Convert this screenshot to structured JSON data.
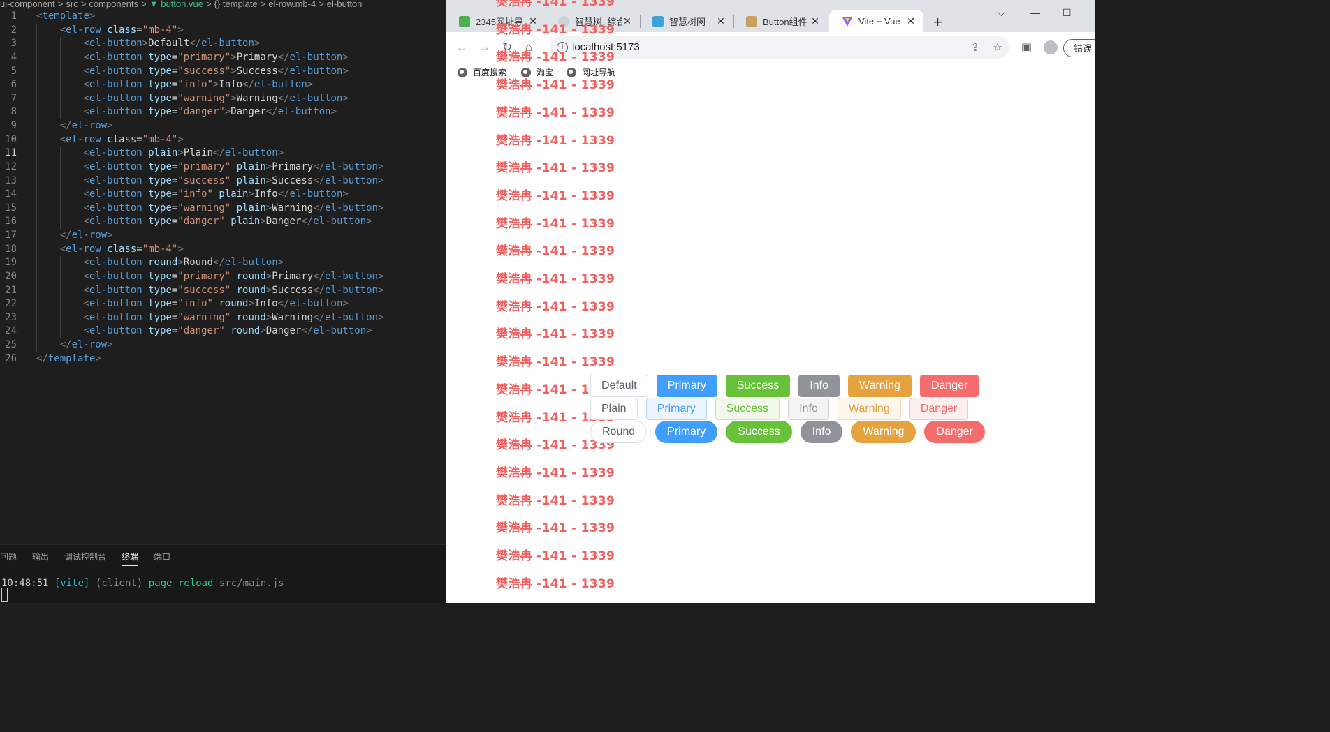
{
  "editor": {
    "breadcrumbs": [
      "ui-component",
      ">",
      "src",
      ">",
      "components",
      ">",
      "button.vue",
      ">",
      "{} template",
      ">",
      "el-row.mb-4",
      ">",
      "el-button"
    ],
    "lines": [
      {
        "n": "1",
        "indent": 1,
        "tokens": [
          [
            "g",
            "<"
          ],
          [
            "t",
            "template"
          ],
          [
            "g",
            ">"
          ]
        ]
      },
      {
        "n": "2",
        "indent": 2,
        "tokens": [
          [
            "g",
            "<"
          ],
          [
            "t",
            "el-row"
          ],
          [
            "txt",
            " "
          ],
          [
            "a",
            "class"
          ],
          [
            "txt",
            "="
          ],
          [
            "s",
            "\"mb-4\""
          ],
          [
            "g",
            ">"
          ]
        ]
      },
      {
        "n": "3",
        "indent": 3,
        "tokens": [
          [
            "g",
            "<"
          ],
          [
            "t",
            "el-button"
          ],
          [
            "g",
            ">"
          ],
          [
            "txt",
            "Default"
          ],
          [
            "g",
            "</"
          ],
          [
            "t",
            "el-button"
          ],
          [
            "g",
            ">"
          ]
        ]
      },
      {
        "n": "4",
        "indent": 3,
        "tokens": [
          [
            "g",
            "<"
          ],
          [
            "t",
            "el-button"
          ],
          [
            "txt",
            " "
          ],
          [
            "a",
            "type"
          ],
          [
            "txt",
            "="
          ],
          [
            "s",
            "\"primary\""
          ],
          [
            "g",
            ">"
          ],
          [
            "txt",
            "Primary"
          ],
          [
            "g",
            "</"
          ],
          [
            "t",
            "el-button"
          ],
          [
            "g",
            ">"
          ]
        ]
      },
      {
        "n": "5",
        "indent": 3,
        "tokens": [
          [
            "g",
            "<"
          ],
          [
            "t",
            "el-button"
          ],
          [
            "txt",
            " "
          ],
          [
            "a",
            "type"
          ],
          [
            "txt",
            "="
          ],
          [
            "s",
            "\"success\""
          ],
          [
            "g",
            ">"
          ],
          [
            "txt",
            "Success"
          ],
          [
            "g",
            "</"
          ],
          [
            "t",
            "el-button"
          ],
          [
            "g",
            ">"
          ]
        ]
      },
      {
        "n": "6",
        "indent": 3,
        "tokens": [
          [
            "g",
            "<"
          ],
          [
            "t",
            "el-button"
          ],
          [
            "txt",
            " "
          ],
          [
            "a",
            "type"
          ],
          [
            "txt",
            "="
          ],
          [
            "s",
            "\"info\""
          ],
          [
            "g",
            ">"
          ],
          [
            "txt",
            "Info"
          ],
          [
            "g",
            "</"
          ],
          [
            "t",
            "el-button"
          ],
          [
            "g",
            ">"
          ]
        ]
      },
      {
        "n": "7",
        "indent": 3,
        "tokens": [
          [
            "g",
            "<"
          ],
          [
            "t",
            "el-button"
          ],
          [
            "txt",
            " "
          ],
          [
            "a",
            "type"
          ],
          [
            "txt",
            "="
          ],
          [
            "s",
            "\"warning\""
          ],
          [
            "g",
            ">"
          ],
          [
            "txt",
            "Warning"
          ],
          [
            "g",
            "</"
          ],
          [
            "t",
            "el-button"
          ],
          [
            "g",
            ">"
          ]
        ]
      },
      {
        "n": "8",
        "indent": 3,
        "tokens": [
          [
            "g",
            "<"
          ],
          [
            "t",
            "el-button"
          ],
          [
            "txt",
            " "
          ],
          [
            "a",
            "type"
          ],
          [
            "txt",
            "="
          ],
          [
            "s",
            "\"danger\""
          ],
          [
            "g",
            ">"
          ],
          [
            "txt",
            "Danger"
          ],
          [
            "g",
            "</"
          ],
          [
            "t",
            "el-button"
          ],
          [
            "g",
            ">"
          ]
        ]
      },
      {
        "n": "9",
        "indent": 2,
        "tokens": [
          [
            "g",
            "</"
          ],
          [
            "t",
            "el-row"
          ],
          [
            "g",
            ">"
          ]
        ]
      },
      {
        "n": "10",
        "indent": 2,
        "tokens": [
          [
            "g",
            "<"
          ],
          [
            "t",
            "el-row"
          ],
          [
            "txt",
            " "
          ],
          [
            "a",
            "class"
          ],
          [
            "txt",
            "="
          ],
          [
            "s",
            "\"mb-4\""
          ],
          [
            "g",
            ">"
          ]
        ]
      },
      {
        "n": "11",
        "indent": 3,
        "active": true,
        "tokens": [
          [
            "g",
            "<"
          ],
          [
            "t",
            "el-button"
          ],
          [
            "txt",
            " "
          ],
          [
            "a",
            "plain"
          ],
          [
            "g",
            ">"
          ],
          [
            "txt",
            "Plain"
          ],
          [
            "g",
            "</"
          ],
          [
            "t",
            "el-button"
          ],
          [
            "g",
            ">"
          ]
        ]
      },
      {
        "n": "12",
        "indent": 3,
        "tokens": [
          [
            "g",
            "<"
          ],
          [
            "t",
            "el-button"
          ],
          [
            "txt",
            " "
          ],
          [
            "a",
            "type"
          ],
          [
            "txt",
            "="
          ],
          [
            "s",
            "\"primary\""
          ],
          [
            "txt",
            " "
          ],
          [
            "a",
            "plain"
          ],
          [
            "g",
            ">"
          ],
          [
            "txt",
            "Primary"
          ],
          [
            "g",
            "</"
          ],
          [
            "t",
            "el-button"
          ],
          [
            "g",
            ">"
          ]
        ]
      },
      {
        "n": "13",
        "indent": 3,
        "tokens": [
          [
            "g",
            "<"
          ],
          [
            "t",
            "el-button"
          ],
          [
            "txt",
            " "
          ],
          [
            "a",
            "type"
          ],
          [
            "txt",
            "="
          ],
          [
            "s",
            "\"success\""
          ],
          [
            "txt",
            " "
          ],
          [
            "a",
            "plain"
          ],
          [
            "g",
            ">"
          ],
          [
            "txt",
            "Success"
          ],
          [
            "g",
            "</"
          ],
          [
            "t",
            "el-button"
          ],
          [
            "g",
            ">"
          ]
        ]
      },
      {
        "n": "14",
        "indent": 3,
        "tokens": [
          [
            "g",
            "<"
          ],
          [
            "t",
            "el-button"
          ],
          [
            "txt",
            " "
          ],
          [
            "a",
            "type"
          ],
          [
            "txt",
            "="
          ],
          [
            "s",
            "\"info\""
          ],
          [
            "txt",
            " "
          ],
          [
            "a",
            "plain"
          ],
          [
            "g",
            ">"
          ],
          [
            "txt",
            "Info"
          ],
          [
            "g",
            "</"
          ],
          [
            "t",
            "el-button"
          ],
          [
            "g",
            ">"
          ]
        ]
      },
      {
        "n": "15",
        "indent": 3,
        "tokens": [
          [
            "g",
            "<"
          ],
          [
            "t",
            "el-button"
          ],
          [
            "txt",
            " "
          ],
          [
            "a",
            "type"
          ],
          [
            "txt",
            "="
          ],
          [
            "s",
            "\"warning\""
          ],
          [
            "txt",
            " "
          ],
          [
            "a",
            "plain"
          ],
          [
            "g",
            ">"
          ],
          [
            "txt",
            "Warning"
          ],
          [
            "g",
            "</"
          ],
          [
            "t",
            "el-button"
          ],
          [
            "g",
            ">"
          ]
        ]
      },
      {
        "n": "16",
        "indent": 3,
        "tokens": [
          [
            "g",
            "<"
          ],
          [
            "t",
            "el-button"
          ],
          [
            "txt",
            " "
          ],
          [
            "a",
            "type"
          ],
          [
            "txt",
            "="
          ],
          [
            "s",
            "\"danger\""
          ],
          [
            "txt",
            " "
          ],
          [
            "a",
            "plain"
          ],
          [
            "g",
            ">"
          ],
          [
            "txt",
            "Danger"
          ],
          [
            "g",
            "</"
          ],
          [
            "t",
            "el-button"
          ],
          [
            "g",
            ">"
          ]
        ]
      },
      {
        "n": "17",
        "indent": 2,
        "tokens": [
          [
            "g",
            "</"
          ],
          [
            "t",
            "el-row"
          ],
          [
            "g",
            ">"
          ]
        ]
      },
      {
        "n": "18",
        "indent": 2,
        "tokens": [
          [
            "g",
            "<"
          ],
          [
            "t",
            "el-row"
          ],
          [
            "txt",
            " "
          ],
          [
            "a",
            "class"
          ],
          [
            "txt",
            "="
          ],
          [
            "s",
            "\"mb-4\""
          ],
          [
            "g",
            ">"
          ]
        ]
      },
      {
        "n": "19",
        "indent": 3,
        "tokens": [
          [
            "g",
            "<"
          ],
          [
            "t",
            "el-button"
          ],
          [
            "txt",
            " "
          ],
          [
            "a",
            "round"
          ],
          [
            "g",
            ">"
          ],
          [
            "txt",
            "Round"
          ],
          [
            "g",
            "</"
          ],
          [
            "t",
            "el-button"
          ],
          [
            "g",
            ">"
          ]
        ]
      },
      {
        "n": "20",
        "indent": 3,
        "tokens": [
          [
            "g",
            "<"
          ],
          [
            "t",
            "el-button"
          ],
          [
            "txt",
            " "
          ],
          [
            "a",
            "type"
          ],
          [
            "txt",
            "="
          ],
          [
            "s",
            "\"primary\""
          ],
          [
            "txt",
            " "
          ],
          [
            "a",
            "round"
          ],
          [
            "g",
            ">"
          ],
          [
            "txt",
            "Primary"
          ],
          [
            "g",
            "</"
          ],
          [
            "t",
            "el-button"
          ],
          [
            "g",
            ">"
          ]
        ]
      },
      {
        "n": "21",
        "indent": 3,
        "tokens": [
          [
            "g",
            "<"
          ],
          [
            "t",
            "el-button"
          ],
          [
            "txt",
            " "
          ],
          [
            "a",
            "type"
          ],
          [
            "txt",
            "="
          ],
          [
            "s",
            "\"success\""
          ],
          [
            "txt",
            " "
          ],
          [
            "a",
            "round"
          ],
          [
            "g",
            ">"
          ],
          [
            "txt",
            "Success"
          ],
          [
            "g",
            "</"
          ],
          [
            "t",
            "el-button"
          ],
          [
            "g",
            ">"
          ]
        ]
      },
      {
        "n": "22",
        "indent": 3,
        "tokens": [
          [
            "g",
            "<"
          ],
          [
            "t",
            "el-button"
          ],
          [
            "txt",
            " "
          ],
          [
            "a",
            "type"
          ],
          [
            "txt",
            "="
          ],
          [
            "s",
            "\"info\""
          ],
          [
            "txt",
            " "
          ],
          [
            "a",
            "round"
          ],
          [
            "g",
            ">"
          ],
          [
            "txt",
            "Info"
          ],
          [
            "g",
            "</"
          ],
          [
            "t",
            "el-button"
          ],
          [
            "g",
            ">"
          ]
        ]
      },
      {
        "n": "23",
        "indent": 3,
        "tokens": [
          [
            "g",
            "<"
          ],
          [
            "t",
            "el-button"
          ],
          [
            "txt",
            " "
          ],
          [
            "a",
            "type"
          ],
          [
            "txt",
            "="
          ],
          [
            "s",
            "\"warning\""
          ],
          [
            "txt",
            " "
          ],
          [
            "a",
            "round"
          ],
          [
            "g",
            ">"
          ],
          [
            "txt",
            "Warning"
          ],
          [
            "g",
            "</"
          ],
          [
            "t",
            "el-button"
          ],
          [
            "g",
            ">"
          ]
        ]
      },
      {
        "n": "24",
        "indent": 3,
        "tokens": [
          [
            "g",
            "<"
          ],
          [
            "t",
            "el-button"
          ],
          [
            "txt",
            " "
          ],
          [
            "a",
            "type"
          ],
          [
            "txt",
            "="
          ],
          [
            "s",
            "\"danger\""
          ],
          [
            "txt",
            " "
          ],
          [
            "a",
            "round"
          ],
          [
            "g",
            ">"
          ],
          [
            "txt",
            "Danger"
          ],
          [
            "g",
            "</"
          ],
          [
            "t",
            "el-button"
          ],
          [
            "g",
            ">"
          ]
        ]
      },
      {
        "n": "25",
        "indent": 2,
        "tokens": [
          [
            "g",
            "</"
          ],
          [
            "t",
            "el-row"
          ],
          [
            "g",
            ">"
          ]
        ]
      },
      {
        "n": "26",
        "indent": 1,
        "tokens": [
          [
            "g",
            "</"
          ],
          [
            "t",
            "template"
          ],
          [
            "g",
            ">"
          ]
        ]
      }
    ]
  },
  "panel": {
    "tabs": [
      "问题",
      "输出",
      "调试控制台",
      "终端",
      "端口"
    ],
    "active_tab": "终端",
    "terminal": {
      "time": "10:48:51",
      "tag": "[vite]",
      "client": "(client)",
      "action": "page reload",
      "file": "src/main.js"
    }
  },
  "browser": {
    "tabs": [
      {
        "title": "2345网址导",
        "active": false
      },
      {
        "title": "智慧树_综合",
        "active": false
      },
      {
        "title": "智慧树网",
        "active": false
      },
      {
        "title": "Button组件",
        "active": false
      },
      {
        "title": "Vite + Vue",
        "active": true
      }
    ],
    "url": "localhost:5173",
    "error_button": "错误",
    "bookmarks": [
      "百度搜索",
      "淘宝",
      "网址导航"
    ],
    "watermark": "樊浩冉 -141 - 1339",
    "button_rows": [
      [
        {
          "label": "Default",
          "style": ""
        },
        {
          "label": "Primary",
          "style": "primary"
        },
        {
          "label": "Success",
          "style": "success"
        },
        {
          "label": "Info",
          "style": "info"
        },
        {
          "label": "Warning",
          "style": "warning"
        },
        {
          "label": "Danger",
          "style": "danger"
        }
      ],
      [
        {
          "label": "Plain",
          "style": ""
        },
        {
          "label": "Primary",
          "style": "plain-primary"
        },
        {
          "label": "Success",
          "style": "plain-success"
        },
        {
          "label": "Info",
          "style": "plain-info"
        },
        {
          "label": "Warning",
          "style": "plain-warning"
        },
        {
          "label": "Danger",
          "style": "plain-danger"
        }
      ],
      [
        {
          "label": "Round",
          "style": "round"
        },
        {
          "label": "Primary",
          "style": "round primary"
        },
        {
          "label": "Success",
          "style": "round success"
        },
        {
          "label": "Info",
          "style": "round info"
        },
        {
          "label": "Warning",
          "style": "round warning"
        },
        {
          "label": "Danger",
          "style": "round danger"
        }
      ]
    ]
  }
}
